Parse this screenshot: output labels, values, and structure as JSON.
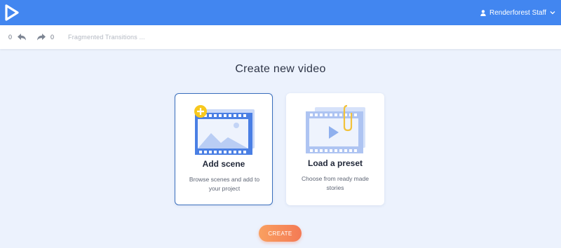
{
  "header": {
    "logo_icon": "play-triangle-logo-icon",
    "user_icon": "user-icon",
    "user_name": "Renderforest Staff",
    "dropdown_icon": "chevron-down-icon"
  },
  "toolbar": {
    "undo_count": "0",
    "undo_icon": "undo-icon",
    "redo_count": "0",
    "redo_icon": "redo-icon",
    "project_title": "Fragmented Transitions ..."
  },
  "main": {
    "heading": "Create new video",
    "cards": [
      {
        "title": "Add scene",
        "description": "Browse scenes and add to your project",
        "selected": true,
        "icon": "film-add-scene-icon"
      },
      {
        "title": "Load a preset",
        "description": "Choose from ready made stories",
        "selected": false,
        "icon": "film-preset-clip-icon"
      }
    ],
    "create_label": "CREATE"
  },
  "colors": {
    "header_bg": "#4286f0",
    "page_bg": "#ecf2fd",
    "selected_border": "#3a6fbd",
    "create_gradient_start": "#f9a060",
    "create_gradient_end": "#f47a55"
  }
}
